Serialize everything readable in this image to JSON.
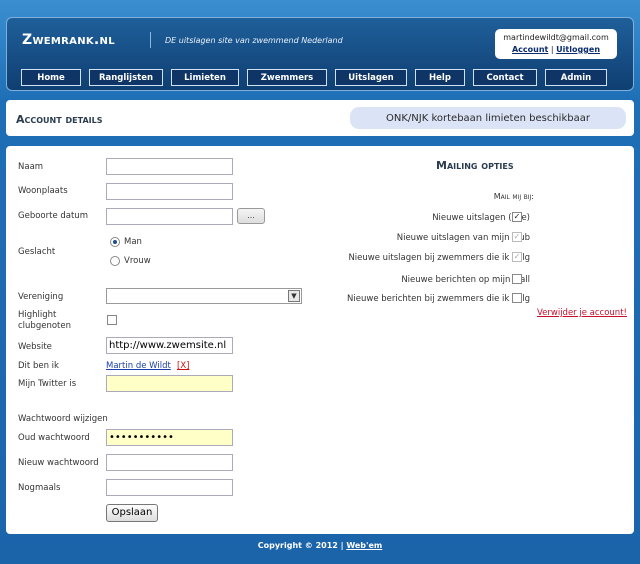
{
  "header": {
    "logo": "Zwemrank.nl",
    "tagline": "DE uitslagen site van zwemmend Nederland",
    "user_email": "martindewildt@gmail.com",
    "account_link": "Account",
    "user_sep": "|",
    "logout_link": "Uitloggen"
  },
  "nav": [
    {
      "label": "Home"
    },
    {
      "label": "Ranglijsten"
    },
    {
      "label": "Limieten"
    },
    {
      "label": "Zwemmers"
    },
    {
      "label": "Uitslagen"
    },
    {
      "label": "Help"
    },
    {
      "label": "Contact"
    },
    {
      "label": "Admin"
    }
  ],
  "titlebar": {
    "title": "Account details",
    "notice": "ONK/NJK kortebaan limieten beschikbaar"
  },
  "form": {
    "naam_label": "Naam",
    "naam_value": "",
    "woonplaats_label": "Woonplaats",
    "woonplaats_value": "",
    "geboorte_label": "Geboorte datum",
    "geboorte_value": "",
    "date_button": "...",
    "geslacht_label": "Geslacht",
    "gender_man": "Man",
    "gender_vrouw": "Vrouw",
    "gender_selected": "Man",
    "vereniging_label": "Vereniging",
    "vereniging_value": "",
    "highlight_label_1": "Highlight",
    "highlight_label_2": "clubgenoten",
    "highlight_checked": false,
    "website_label": "Website",
    "website_value": "http://www.zwemsite.nl",
    "ditbenik_label": "Dit ben ik",
    "ditbenik_link": "Martin de Wildt",
    "ditbenik_remove": "[X]",
    "twitter_label": "Mijn Twitter is",
    "twitter_value": "",
    "password_section": "Wachtwoord wijzigen",
    "oud_label": "Oud wachtwoord",
    "oud_value": "•••••••••••",
    "nieuw_label": "Nieuw wachtwoord",
    "nieuw_value": "",
    "nogmaals_label": "Nogmaals",
    "nogmaals_value": "",
    "save_button": "Opslaan"
  },
  "mailing": {
    "title": "Mailing opties",
    "subtitle": "Mail mij bij:",
    "options": [
      {
        "label": "Nieuwe uitslagen (alle)",
        "checked": true,
        "disabled": false
      },
      {
        "label": "Nieuwe uitslagen van mijn club",
        "checked": true,
        "disabled": true
      },
      {
        "label": "Nieuwe uitslagen bij zwemmers die ik volg",
        "checked": true,
        "disabled": true
      },
      {
        "label": "Nieuwe berichten op mijn wall",
        "checked": false,
        "disabled": false
      },
      {
        "label": "Nieuwe berichten bij zwemmers die ik volg",
        "checked": false,
        "disabled": false
      }
    ],
    "delete_link": "Verwijder je account!"
  },
  "footer": {
    "copyright": "Copyright © 2012 |",
    "link": "Web'em"
  },
  "colors": {
    "background": "#1f6fb6",
    "header": "#0f3f72",
    "notice_bg": "#dbe4f6",
    "delete_link": "#c8102e"
  }
}
